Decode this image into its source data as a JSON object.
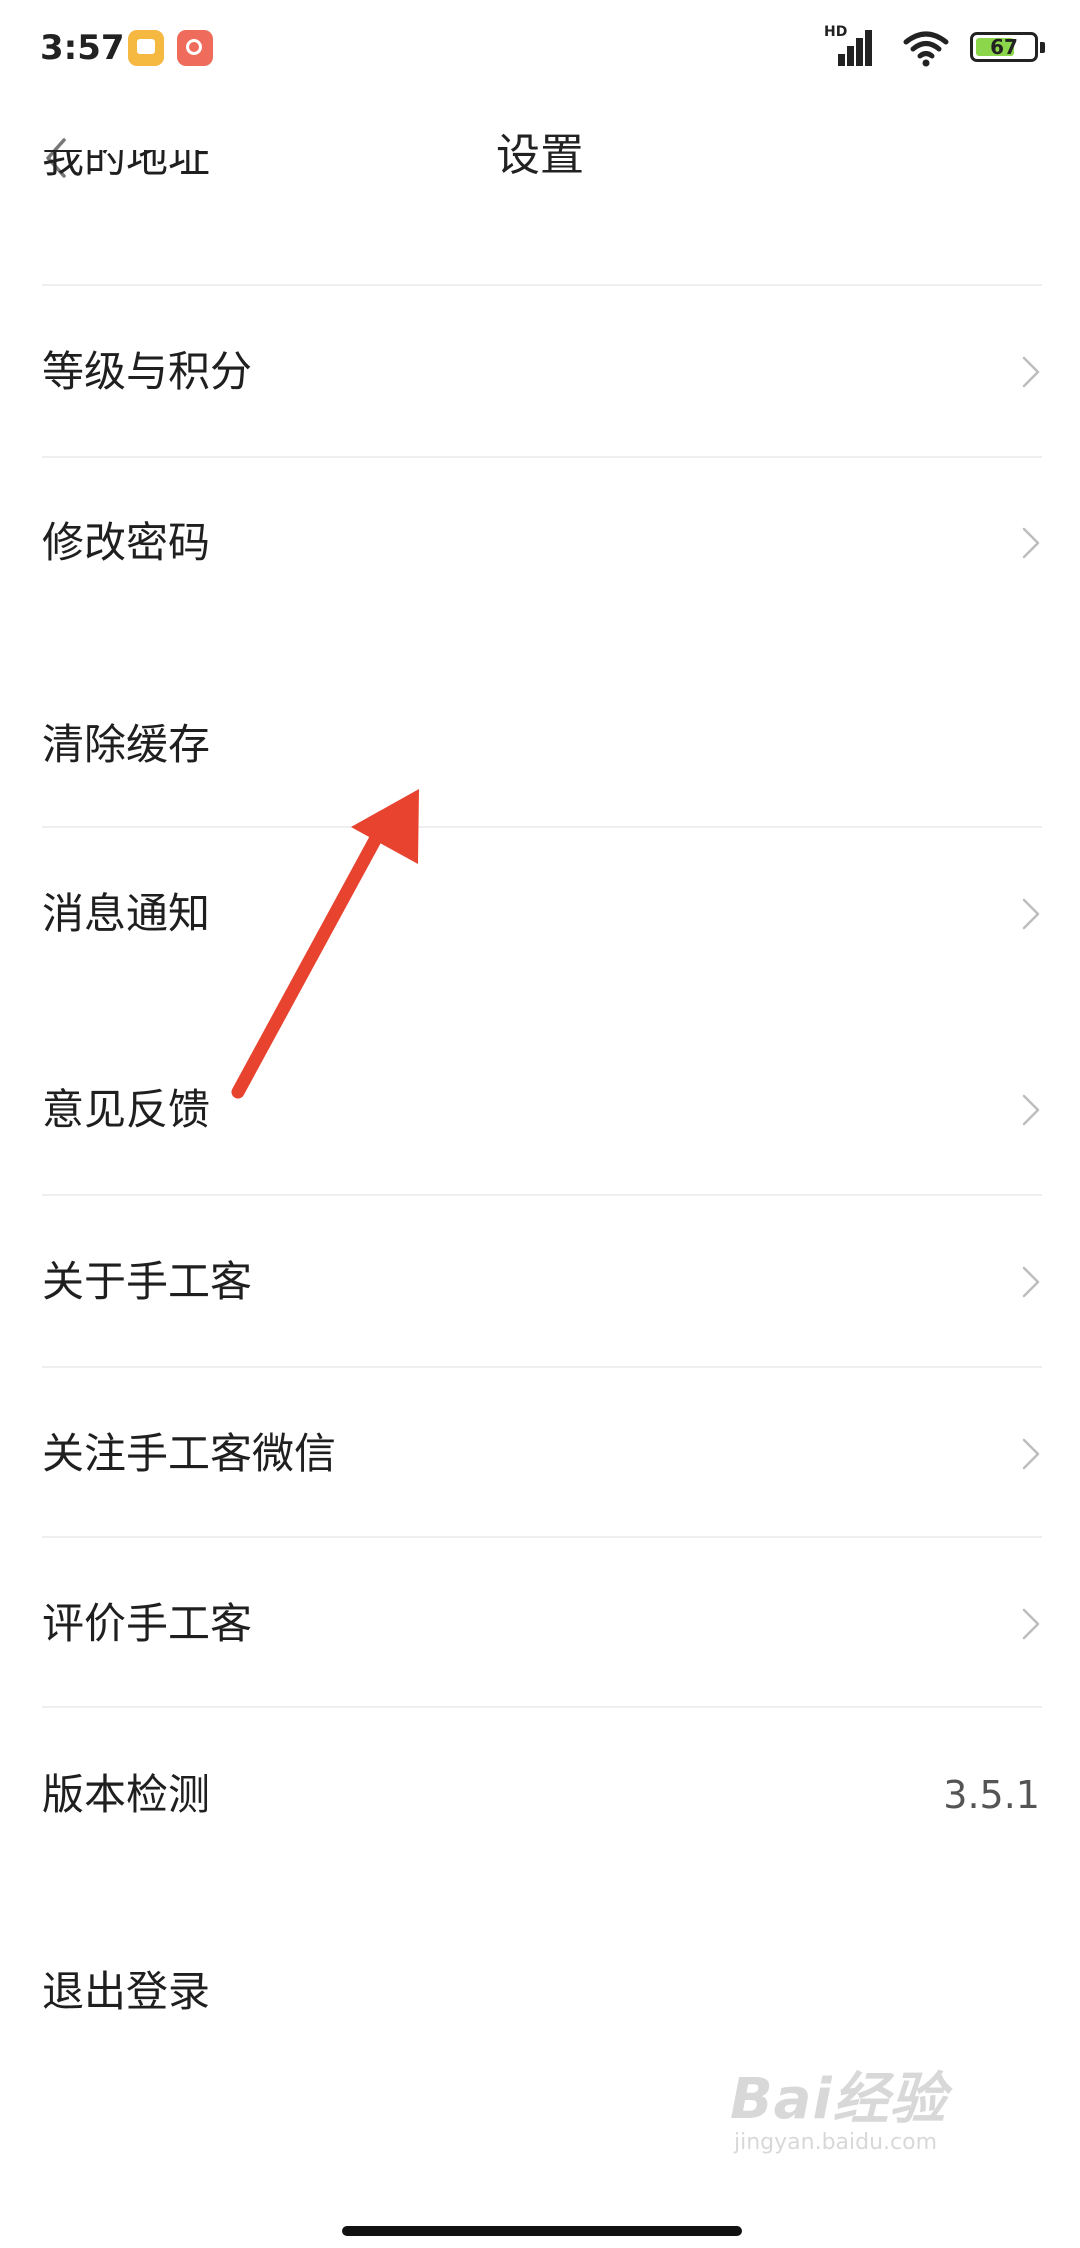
{
  "status_bar": {
    "time": "3:57",
    "network": "HD",
    "battery": "67",
    "battery_level_percent": 67,
    "battery_color": "#8bd64a"
  },
  "nav": {
    "title": "设置",
    "back_icon": "chevron-left-icon"
  },
  "list": {
    "partial_top_label": "我的地址",
    "items": [
      {
        "label": "等级与积分",
        "chevron": true
      },
      {
        "label": "修改密码",
        "chevron": true
      },
      {
        "label": "清除缓存",
        "chevron": false
      },
      {
        "label": "消息通知",
        "chevron": true
      },
      {
        "label": "意见反馈",
        "chevron": true
      },
      {
        "label": "关于手工客",
        "chevron": true
      },
      {
        "label": "关注手工客微信",
        "chevron": true
      },
      {
        "label": "评价手工客",
        "chevron": true
      },
      {
        "label": "版本检测",
        "chevron": false,
        "value": "3.5.1"
      },
      {
        "label": "退出登录",
        "chevron": false
      }
    ]
  },
  "annotation": {
    "type": "arrow",
    "color": "#e8432f"
  },
  "watermark": {
    "line1": "Bai经验",
    "line2": "jingyan.baidu.com"
  }
}
